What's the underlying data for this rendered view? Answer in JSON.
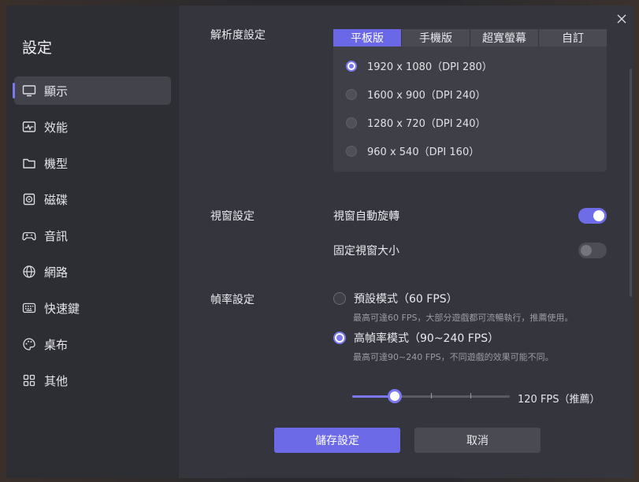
{
  "sidebar": {
    "title": "設定",
    "items": [
      {
        "label": "顯示",
        "icon": "monitor-icon"
      },
      {
        "label": "效能",
        "icon": "performance-icon"
      },
      {
        "label": "機型",
        "icon": "folder-icon"
      },
      {
        "label": "磁碟",
        "icon": "disk-icon"
      },
      {
        "label": "音訊",
        "icon": "gamepad-icon"
      },
      {
        "label": "網路",
        "icon": "globe-icon"
      },
      {
        "label": "快速鍵",
        "icon": "keyboard-icon"
      },
      {
        "label": "桌布",
        "icon": "palette-icon"
      },
      {
        "label": "其他",
        "icon": "grid-icon"
      }
    ],
    "active_index": 0
  },
  "resolution": {
    "label": "解析度設定",
    "tabs": [
      "平板版",
      "手機版",
      "超寬螢幕",
      "自訂"
    ],
    "selected_tab": 0,
    "options": [
      "1920 x 1080（DPI 280）",
      "1600 x 900（DPI 240）",
      "1280 x 720（DPI 240）",
      "960 x 540（DPI 160）"
    ],
    "selected_option": 0
  },
  "window": {
    "label": "視窗設定",
    "auto_rotate_label": "視窗自動旋轉",
    "auto_rotate_on": true,
    "fixed_size_label": "固定視窗大小",
    "fixed_size_on": false
  },
  "fps": {
    "label": "幀率設定",
    "default_mode_label": "預設模式（60 FPS）",
    "default_mode_desc": "最高可達60 FPS，大部分遊戲都可流暢執行，推薦使用。",
    "high_mode_label": "高幀率模式（90~240 FPS）",
    "high_mode_desc": "最高可達90~240 FPS，不同遊戲的效果可能不同。",
    "selected": "high",
    "slider_fraction": 0.27,
    "slider_value_label": "120 FPS（推薦）"
  },
  "buttons": {
    "save": "儲存設定",
    "cancel": "取消"
  },
  "colors": {
    "accent": "#6d6ae8",
    "sidebar_bg": "#2d2d34",
    "content_bg": "#35353d"
  }
}
